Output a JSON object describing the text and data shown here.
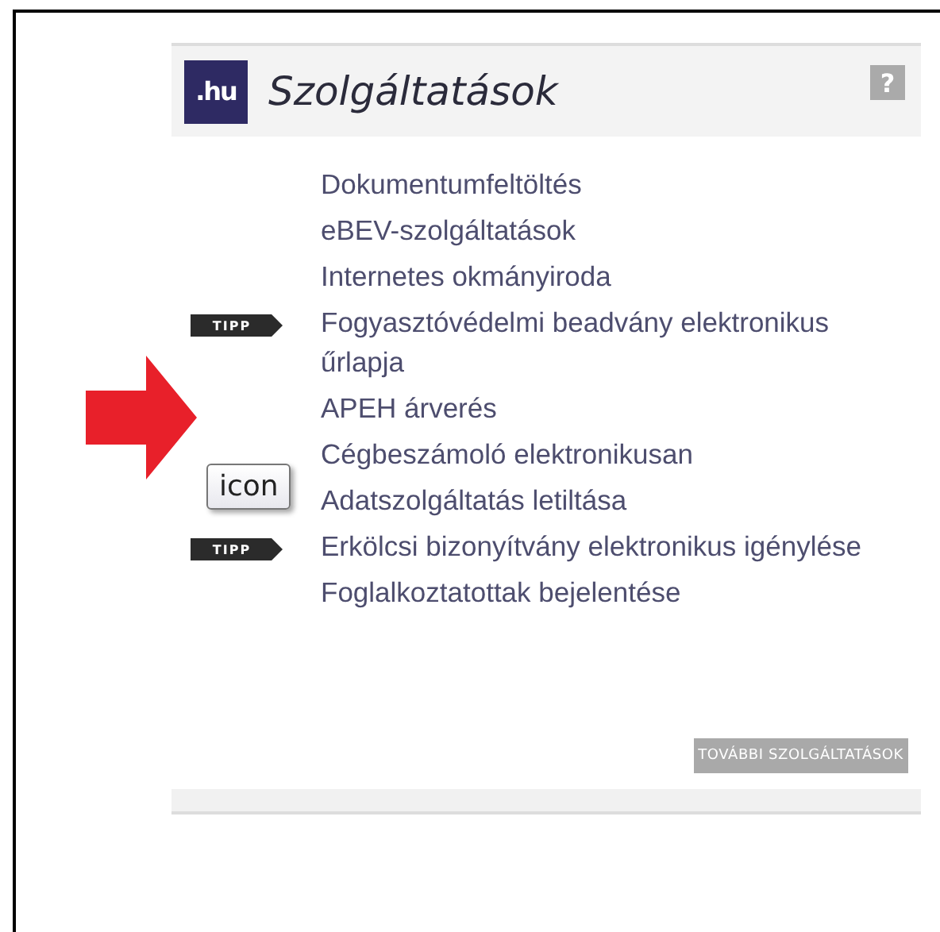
{
  "widget": {
    "logo": ".hu",
    "title": "Szolgáltatások",
    "help": "?",
    "items": [
      {
        "label": "Dokumentumfeltöltés"
      },
      {
        "label": "eBEV-szolgáltatások"
      },
      {
        "label": "Internetes okmányiroda"
      },
      {
        "label": "Fogyasztóvédelmi beadvány elektronikus űrlapja",
        "badge": "TIPP"
      },
      {
        "label": "APEH árverés"
      },
      {
        "label": "Cégbeszámoló elektronikusan"
      },
      {
        "label": "Adatszolgáltatás letiltása"
      },
      {
        "label": "Erkölcsi bizonyítvány elektronikus igénylése",
        "badge": "TIPP"
      },
      {
        "label": "Foglalkoztatottak bejelentése"
      }
    ],
    "more_button": "TOVÁBBI SZOLGÁLTATÁSOK"
  },
  "annotation": {
    "tooltip": "icon"
  }
}
